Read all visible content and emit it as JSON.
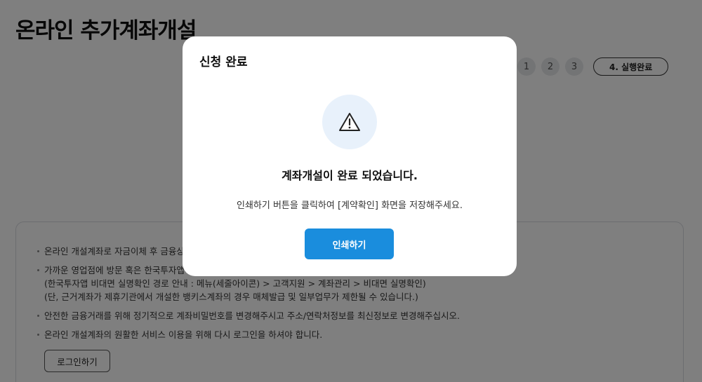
{
  "page": {
    "title": "온라인 추가계좌개설",
    "steps": [
      "1",
      "2",
      "3"
    ],
    "active_step": "4. 실행완료"
  },
  "notices": [
    "온라인 개설계좌로 자금이체 후 금융상품",
    "가까운 영업점에 방문 혹은 한국투자앱에",
    "(한국투자앱 비대면 실명확인 경로 안내 : 메뉴(세줄아이콘) > 고객지원 > 계좌관리 > 비대면 실명확인)",
    "(단, 근거계좌가 제휴기관에서 개설한 뱅키스계좌의 경우 매체발급 및 일부업무가 제한될 수 있습니다.)",
    "안전한 금융거래를 위해 정기적으로 계좌비밀번호를 변경해주시고 주소/연락처정보를 최신정보로 변경해주십시오.",
    "온라인 개설계좌의 원활한 서비스 이용을 위해 다시 로그인을 하셔야 합니다."
  ],
  "login_button": "로그인하기",
  "modal": {
    "title": "신청 완료",
    "icon": "warning-triangle-icon",
    "heading": "계좌개설이 완료 되었습니다.",
    "description": "인쇄하기 버튼을 클릭하여 [계약확인] 화면을 저장해주세요.",
    "print_button": "인쇄하기"
  },
  "colors": {
    "primary": "#1a8ddd",
    "icon_bg": "#e8f1fb"
  }
}
